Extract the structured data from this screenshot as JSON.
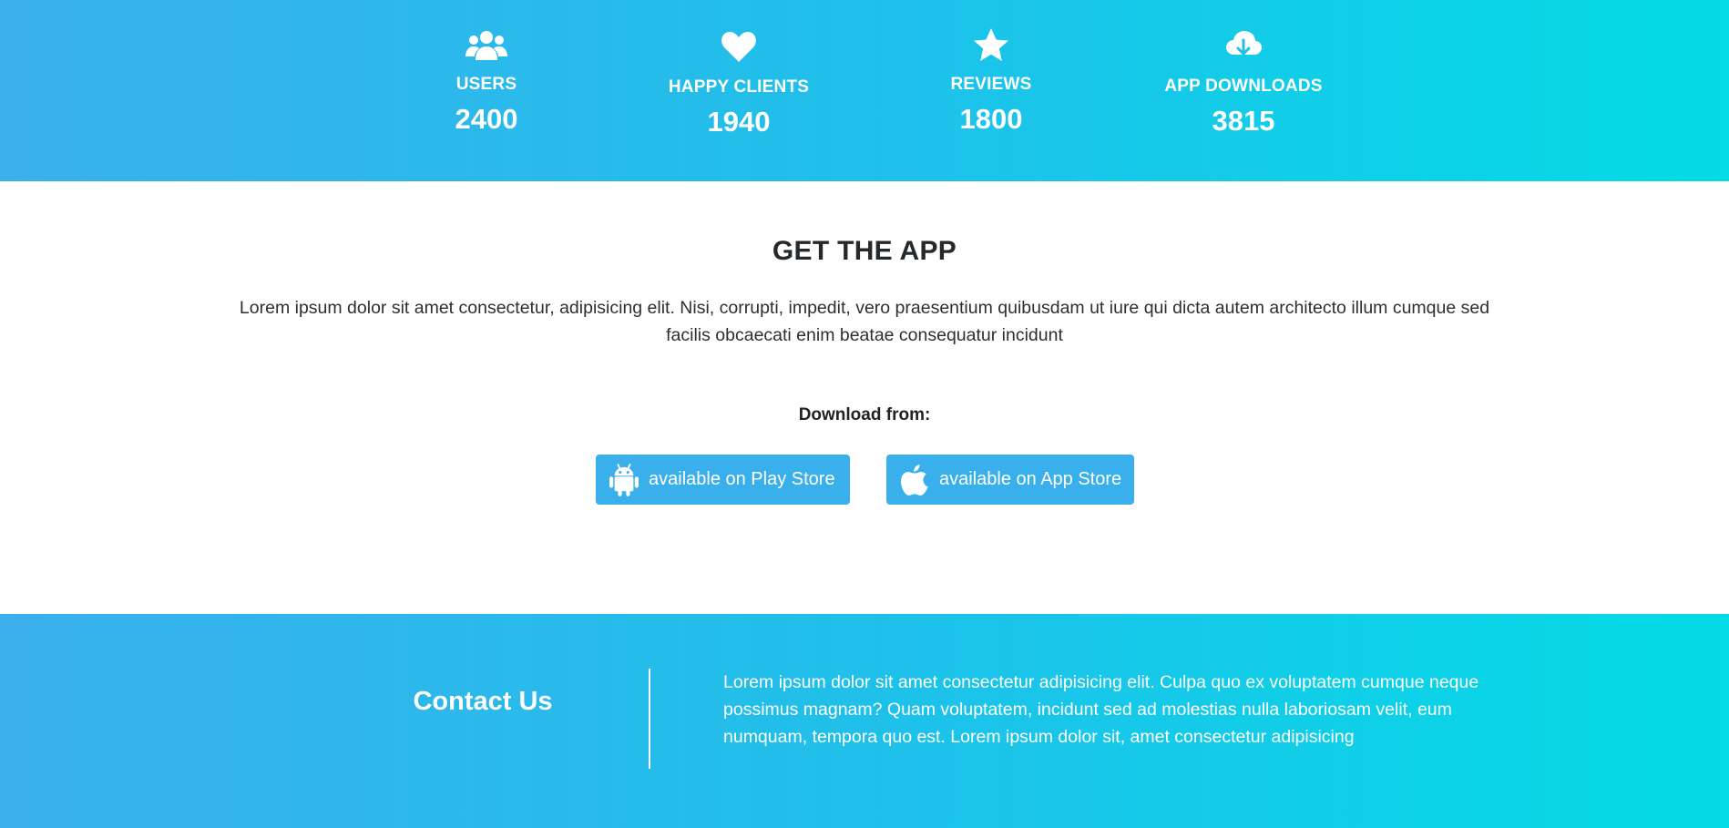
{
  "stats": [
    {
      "icon": "users-icon",
      "label": "USERS",
      "value": "2400"
    },
    {
      "icon": "heart-icon",
      "label": "HAPPY CLIENTS",
      "value": "1940"
    },
    {
      "icon": "star-icon",
      "label": "REVIEWS",
      "value": "1800"
    },
    {
      "icon": "cloud-download-icon",
      "label": "APP DOWNLOADS",
      "value": "3815"
    }
  ],
  "app_section": {
    "title": "GET THE APP",
    "description": "Lorem ipsum dolor sit amet consectetur, adipisicing elit. Nisi, corrupti, impedit, vero praesentium quibusdam ut iure qui dicta autem architecto illum cumque sed facilis obcaecati enim beatae consequatur incidunt",
    "download_label": "Download from:",
    "buttons": [
      {
        "icon": "android-icon",
        "label": "available on Play Store"
      },
      {
        "icon": "apple-icon",
        "label": "available on App Store"
      }
    ]
  },
  "contact": {
    "title": "Contact Us",
    "text": "Lorem ipsum dolor sit amet consectetur adipisicing elit. Culpa quo ex voluptatem cumque neque possimus magnam? Quam voluptatem, incidunt sed ad molestias nulla laboriosam velit, eum numquam, tempora quo est. Lorem ipsum dolor sit, amet consectetur adipisicing"
  },
  "colors": {
    "gradient_start": "#3ab0ec",
    "gradient_end": "#03dbe6",
    "button_bg": "#39b0ec",
    "heading_text": "#26292c"
  }
}
